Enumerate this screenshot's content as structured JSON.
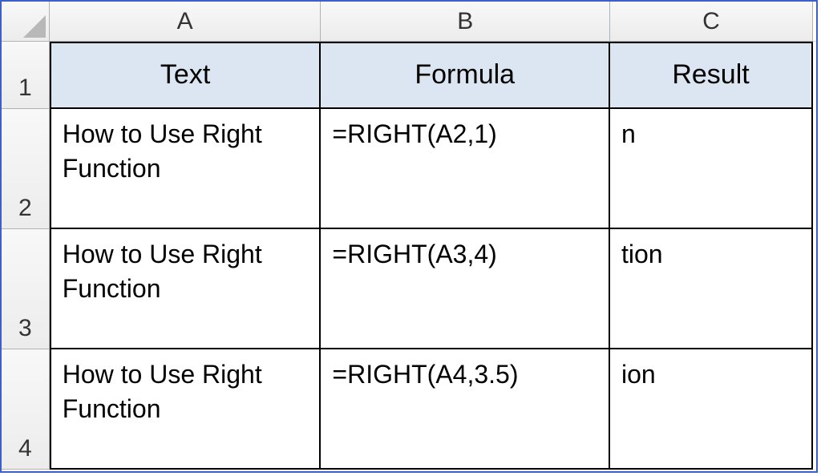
{
  "columns": {
    "a": "A",
    "b": "B",
    "c": "C"
  },
  "row_labels": {
    "r1": "1",
    "r2": "2",
    "r3": "3",
    "r4": "4"
  },
  "headers": {
    "text": "Text",
    "formula": "Formula",
    "result": "Result"
  },
  "rows": [
    {
      "text": "How to Use Right Function",
      "formula": "=RIGHT(A2,1)",
      "result": "n"
    },
    {
      "text": "How to Use Right Function",
      "formula": "=RIGHT(A3,4)",
      "result": "tion"
    },
    {
      "text": "How to Use Right Function",
      "formula": "=RIGHT(A4,3.5)",
      "result": "ion"
    }
  ]
}
